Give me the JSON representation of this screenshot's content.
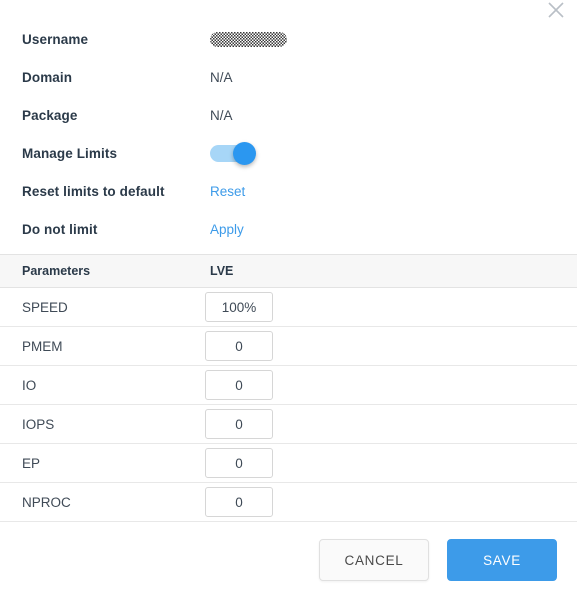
{
  "dialog": {
    "close_icon": "close-icon"
  },
  "info": {
    "rows": [
      {
        "label": "Username",
        "value": "",
        "type": "redacted"
      },
      {
        "label": "Domain",
        "value": "N/A",
        "type": "text"
      },
      {
        "label": "Package",
        "value": "N/A",
        "type": "text"
      },
      {
        "label": "Manage Limits",
        "value": "",
        "type": "toggle",
        "toggle_on": true
      },
      {
        "label": "Reset limits to default",
        "value": "Reset",
        "type": "link"
      },
      {
        "label": "Do not limit",
        "value": "Apply",
        "type": "link"
      }
    ]
  },
  "table": {
    "headers": {
      "parameters": "Parameters",
      "lve": "LVE"
    },
    "rows": [
      {
        "name": "SPEED",
        "lve": "100%"
      },
      {
        "name": "PMEM",
        "lve": "0"
      },
      {
        "name": "IO",
        "lve": "0"
      },
      {
        "name": "IOPS",
        "lve": "0"
      },
      {
        "name": "EP",
        "lve": "0"
      },
      {
        "name": "NPROC",
        "lve": "0"
      }
    ]
  },
  "footer": {
    "cancel_label": "CANCEL",
    "save_label": "SAVE"
  },
  "colors": {
    "accent": "#3d9be9",
    "link": "#3d9be9",
    "toggle_track": "#a7d6f7",
    "toggle_knob": "#2b97f0",
    "label_text": "#2b3a49",
    "header_bg": "#f7f7f7",
    "border": "#e8e8e8"
  }
}
